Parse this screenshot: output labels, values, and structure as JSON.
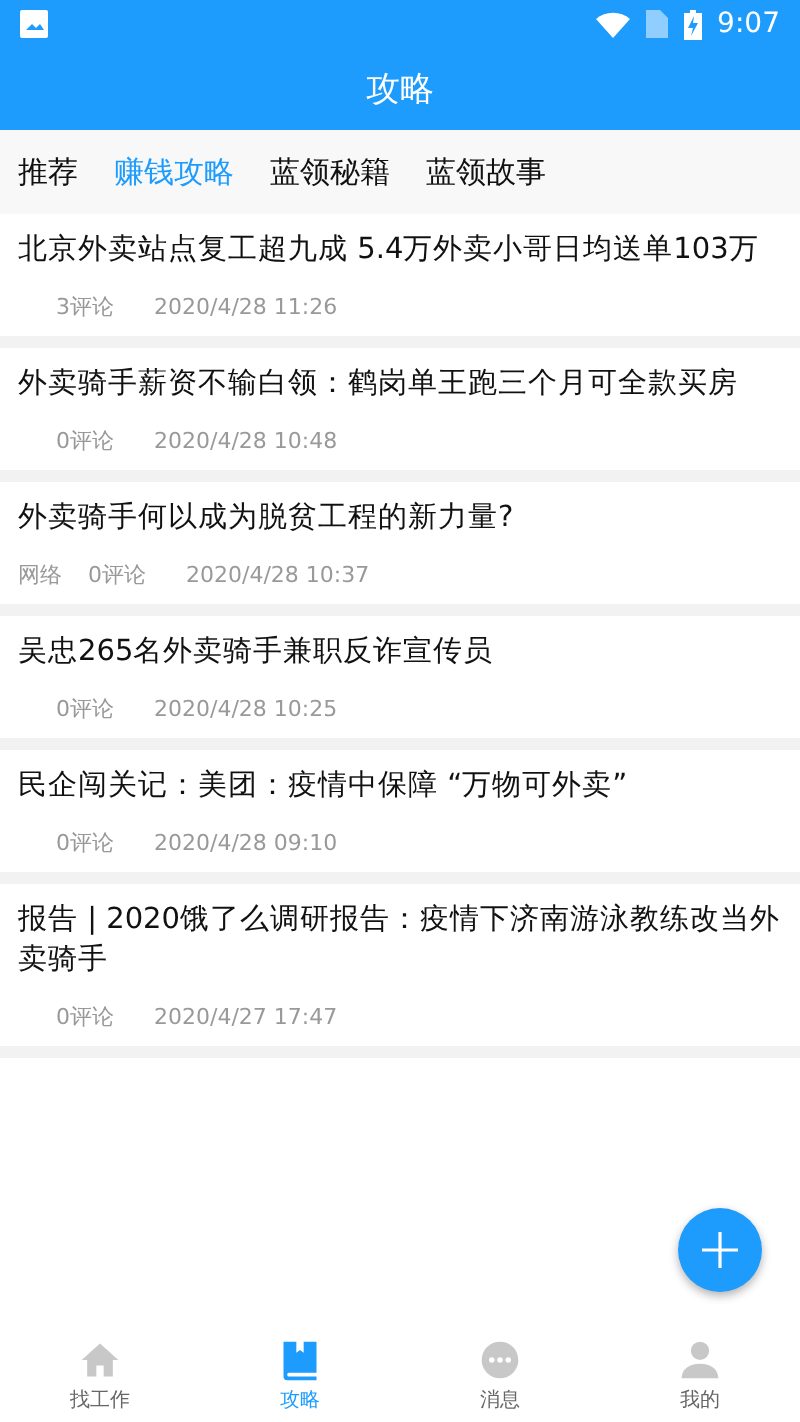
{
  "status_bar": {
    "time": "9:07"
  },
  "title": "攻略",
  "tabs": [
    {
      "label": "推荐",
      "selected": false
    },
    {
      "label": "赚钱攻略",
      "selected": true
    },
    {
      "label": "蓝领秘籍",
      "selected": false
    },
    {
      "label": "蓝领故事",
      "selected": false
    }
  ],
  "articles": [
    {
      "title": "北京外卖站点复工超九成 5.4万外卖小哥日均送单103万",
      "comments": "3评论",
      "time": "2020/4/28 11:26"
    },
    {
      "title": "外卖骑手薪资不输白领：鹤岗单王跑三个月可全款买房",
      "comments": "0评论",
      "time": "2020/4/28 10:48"
    },
    {
      "title": "外卖骑手何以成为脱贫工程的新力量?",
      "source": "网络",
      "comments": "0评论",
      "time": "2020/4/28 10:37"
    },
    {
      "title": "吴忠265名外卖骑手兼职反诈宣传员",
      "comments": "0评论",
      "time": "2020/4/28 10:25"
    },
    {
      "title": "民企闯关记：美团：疫情中保障 “万物可外卖”",
      "comments": "0评论",
      "time": "2020/4/28 09:10"
    },
    {
      "title": "报告 | 2020饿了么调研报告：疫情下济南游泳教练改当外卖骑手",
      "comments": "0评论",
      "time": "2020/4/27 17:47"
    }
  ],
  "bottom_nav": [
    {
      "label": "找工作",
      "selected": false
    },
    {
      "label": "攻略",
      "selected": true
    },
    {
      "label": "消息",
      "selected": false
    },
    {
      "label": "我的",
      "selected": false
    }
  ]
}
